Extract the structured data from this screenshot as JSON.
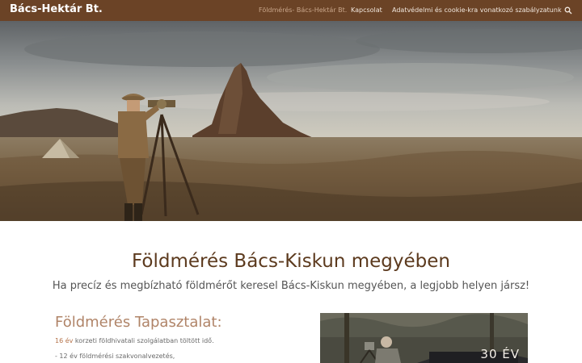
{
  "navbar": {
    "brand": "Bács-Hektár Bt.",
    "items": [
      {
        "label": "Földmérés- Bács-Hektár Bt.",
        "active": true
      },
      {
        "label": "Kapcsolat",
        "active": false
      },
      {
        "label": "Adatvédelmi és cookie-kra vonatkozó szabályzatunk",
        "active": false
      }
    ],
    "search_icon": "search-icon"
  },
  "colors": {
    "navbar_bg": "#6b4326",
    "heading": "#5c3a1e",
    "accent": "#b08468",
    "highlight": "#b5734a"
  },
  "main": {
    "heading": "Földmérés Bács-Kiskun megyében",
    "subheading": "Ha precíz és megbízható földmérőt keresel Bács-Kiskun megyében, a legjobb helyen jársz!",
    "experience": {
      "title": "Földmérés Tapasztalat:",
      "line1_highlight": "16 év",
      "line1_rest": " korzeti földhivatali szolgálatban töltött idő.",
      "line2": "- 12 év földmérési szakvonalvezetés,"
    },
    "photo_caption": "30 ÉV"
  }
}
